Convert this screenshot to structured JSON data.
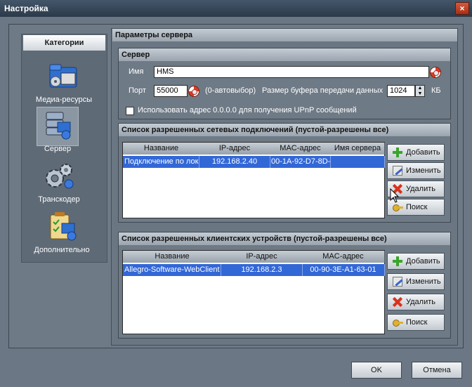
{
  "window": {
    "title": "Настройка",
    "close_label": "×"
  },
  "categories": {
    "header": "Категории",
    "items": [
      {
        "label": "Медиа-ресурсы",
        "icon": "media-folder-icon"
      },
      {
        "label": "Сервер",
        "icon": "server-icon",
        "selected": true
      },
      {
        "label": "Транскодер",
        "icon": "gears-icon"
      },
      {
        "label": "Дополнительно",
        "icon": "checklist-icon"
      }
    ]
  },
  "settings": {
    "title": "Параметры сервера",
    "server": {
      "title": "Сервер",
      "name_label": "Имя",
      "name_value": "HMS",
      "port_label": "Порт",
      "port_value": "55000",
      "port_hint": "(0-автовыбор)",
      "buffer_label": "Размер буфера передачи данных",
      "buffer_value": "1024",
      "buffer_unit": "КБ",
      "upnp_label": "Использовать адрес 0.0.0.0 для получения UPnP сообщений",
      "upnp_checked": false
    },
    "connections": {
      "title": "Список разрешенных сетевых подключений (пустой-разрешены все)",
      "columns": [
        "Название",
        "IP-адрес",
        "MAC-адрес",
        "Имя сервера"
      ],
      "rows": [
        {
          "name": "Подключение по лок",
          "ip": "192.168.2.40",
          "mac": "00-1A-92-D7-8D-",
          "server": ""
        }
      ],
      "buttons": {
        "add": "Добавить",
        "edit": "Изменить",
        "delete": "Удалить",
        "search": "Поиск"
      }
    },
    "devices": {
      "title": "Список разрешенных клиентских устройств (пустой-разрешены все)",
      "columns": [
        "Название",
        "IP-адрес",
        "MAC-адрес"
      ],
      "rows": [
        {
          "name": "Allegro-Software-WebClient",
          "ip": "192.168.2.3",
          "mac": "00-90-3E-A1-63-01"
        }
      ],
      "buttons": {
        "add": "Добавить",
        "edit": "Изменить",
        "delete": "Удалить",
        "search": "Поиск"
      }
    }
  },
  "footer": {
    "ok": "OK",
    "cancel": "Отмена"
  }
}
